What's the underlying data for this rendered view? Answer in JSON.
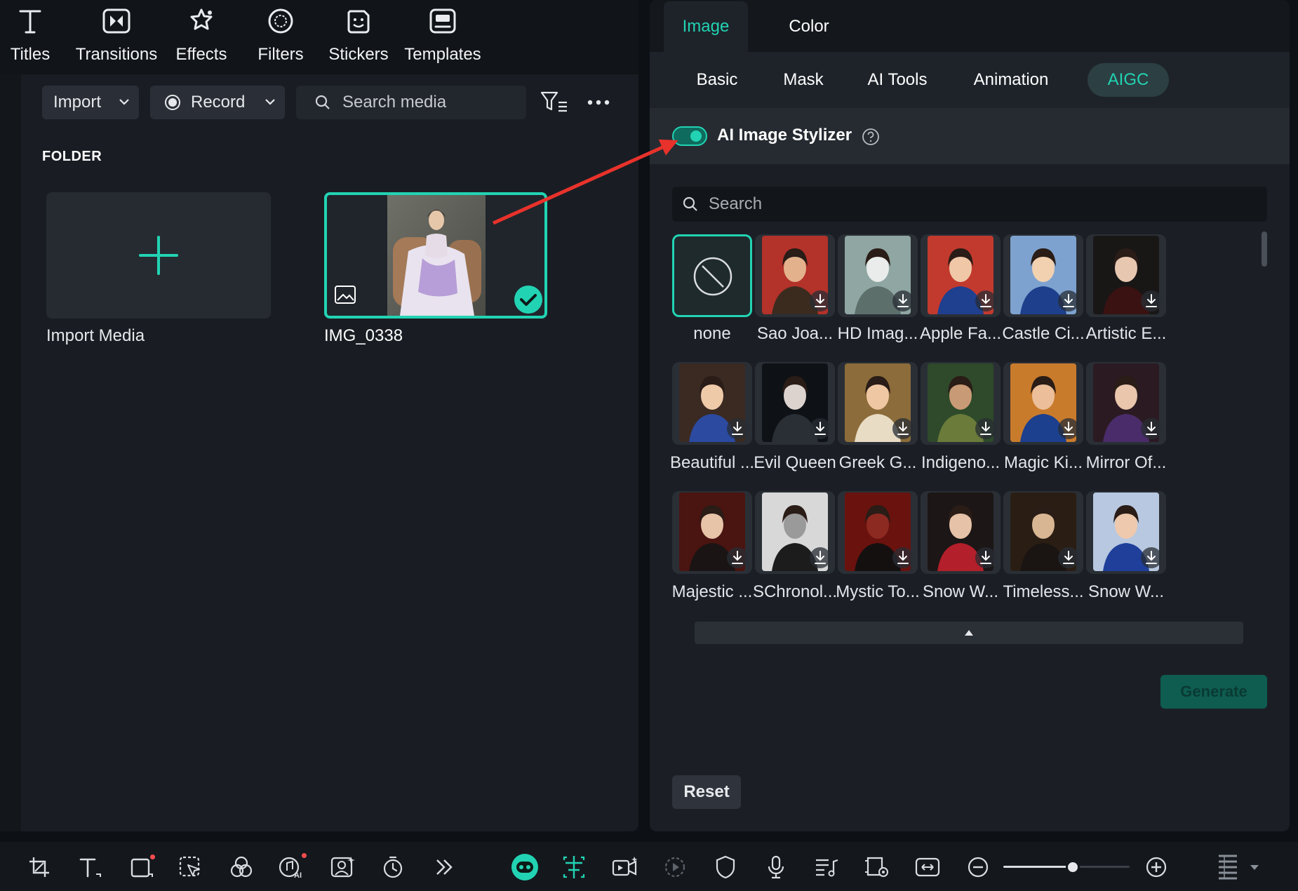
{
  "toolbar": {
    "tools": [
      {
        "label": "Titles",
        "icon": "titles-icon"
      },
      {
        "label": "Transitions",
        "icon": "transitions-icon"
      },
      {
        "label": "Effects",
        "icon": "effects-icon"
      },
      {
        "label": "Filters",
        "icon": "filters-icon"
      },
      {
        "label": "Stickers",
        "icon": "stickers-icon"
      },
      {
        "label": "Templates",
        "icon": "templates-icon"
      }
    ]
  },
  "media_controls": {
    "import_label": "Import",
    "record_label": "Record",
    "search_placeholder": "Search media"
  },
  "folder": {
    "heading": "FOLDER",
    "import_media_label": "Import Media",
    "media_items": [
      {
        "name": "IMG_0338",
        "selected": true
      }
    ]
  },
  "right_panel": {
    "top_tabs": [
      {
        "label": "Image",
        "active": true
      },
      {
        "label": "Color",
        "active": false
      }
    ],
    "sub_tabs": [
      {
        "label": "Basic",
        "active": false
      },
      {
        "label": "Mask",
        "active": false
      },
      {
        "label": "AI Tools",
        "active": false
      },
      {
        "label": "Animation",
        "active": false
      },
      {
        "label": "AIGC",
        "active": true
      }
    ],
    "stylizer": {
      "label": "AI Image Stylizer",
      "enabled": true
    },
    "style_search_placeholder": "Search",
    "styles": [
      {
        "label": "none",
        "selected": true
      },
      {
        "label": "Sao Joa..."
      },
      {
        "label": "HD Imag..."
      },
      {
        "label": "Apple Fa..."
      },
      {
        "label": "Castle Ci..."
      },
      {
        "label": "Artistic E..."
      },
      {
        "label": "Beautiful ..."
      },
      {
        "label": "Evil Queen"
      },
      {
        "label": "Greek G..."
      },
      {
        "label": "Indigeno..."
      },
      {
        "label": "Magic Ki..."
      },
      {
        "label": "Mirror Of..."
      },
      {
        "label": "Majestic ..."
      },
      {
        "label": "SChronol..."
      },
      {
        "label": "Mystic To..."
      },
      {
        "label": "Snow W..."
      },
      {
        "label": "Timeless..."
      },
      {
        "label": "Snow W..."
      }
    ],
    "generate_label": "Generate",
    "reset_label": "Reset"
  },
  "colors": {
    "accent": "#22d3b3",
    "annotation_arrow": "#e8322b"
  },
  "bottom_toolbar": {
    "zoom_level": 0.55
  }
}
